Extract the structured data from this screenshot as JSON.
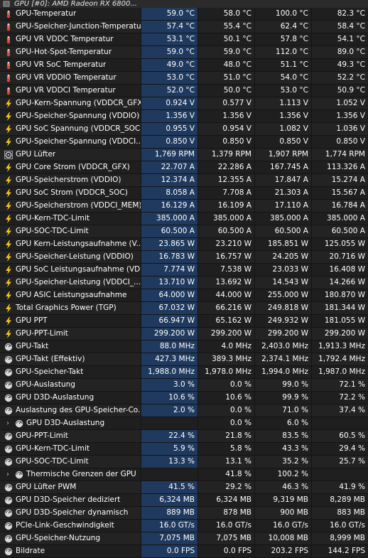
{
  "header": {
    "title": "GPU [#0]: AMD Radeon RX 6800..."
  },
  "rows": [
    {
      "icon": "thermometer",
      "label": "GPU-Temperatur",
      "current": "59.0 °C",
      "min": "58.0 °C",
      "max": "100.0 °C",
      "avg": "82.3 °C"
    },
    {
      "icon": "thermometer",
      "label": "GPU-Speicher-Junction-Temperatur",
      "current": "57.4 °C",
      "min": "55.4 °C",
      "max": "62.4 °C",
      "avg": "58.4 °C"
    },
    {
      "icon": "thermometer",
      "label": "GPU VR VDDC Temperatur",
      "current": "53.1 °C",
      "min": "50.1 °C",
      "max": "57.8 °C",
      "avg": "54.1 °C"
    },
    {
      "icon": "thermometer",
      "label": "GPU-Hot-Spot-Temperatur",
      "current": "59.0 °C",
      "min": "59.0 °C",
      "max": "112.0 °C",
      "avg": "89.0 °C"
    },
    {
      "icon": "thermometer",
      "label": "GPU VR SoC Temperatur",
      "current": "49.0 °C",
      "min": "48.0 °C",
      "max": "51.1 °C",
      "avg": "49.3 °C"
    },
    {
      "icon": "thermometer",
      "label": "GPU VR VDDIO Temperatur",
      "current": "53.0 °C",
      "min": "51.0 °C",
      "max": "54.0 °C",
      "avg": "52.2 °C"
    },
    {
      "icon": "thermometer",
      "label": "GPU VR VDDCI Temperatur",
      "current": "52.0 °C",
      "min": "50.0 °C",
      "max": "53.0 °C",
      "avg": "50.9 °C"
    },
    {
      "icon": "bolt",
      "label": "GPU-Kern-Spannung (VDDCR_GFX)",
      "current": "0.924 V",
      "min": "0.577 V",
      "max": "1.113 V",
      "avg": "1.052 V"
    },
    {
      "icon": "bolt",
      "label": "GPU-Speicher-Spannung (VDDIO)",
      "current": "1.356 V",
      "min": "1.356 V",
      "max": "1.356 V",
      "avg": "1.356 V"
    },
    {
      "icon": "bolt",
      "label": "GPU SoC Spannung (VDDCR_SOC)",
      "current": "0.955 V",
      "min": "0.954 V",
      "max": "1.082 V",
      "avg": "1.036 V"
    },
    {
      "icon": "bolt",
      "label": "GPU-Speicher-Spannung (VDDCI...",
      "current": "0.850 V",
      "min": "0.850 V",
      "max": "0.850 V",
      "avg": "0.850 V"
    },
    {
      "icon": "fan",
      "label": "GPU Lüfter",
      "current": "1,769 RPM",
      "min": "1,379 RPM",
      "max": "1,907 RPM",
      "avg": "1,774 RPM"
    },
    {
      "icon": "bolt",
      "label": "GPU Core Strom (VDDCR_GFX)",
      "current": "22.707 A",
      "min": "22.286 A",
      "max": "167.745 A",
      "avg": "113.326 A"
    },
    {
      "icon": "bolt",
      "label": "GPU-Speicherstrom (VDDIO)",
      "current": "12.374 A",
      "min": "12.355 A",
      "max": "17.847 A",
      "avg": "15.274 A"
    },
    {
      "icon": "bolt",
      "label": "GPU SoC Strom (VDDCR_SOC)",
      "current": "8.058 A",
      "min": "7.708 A",
      "max": "21.303 A",
      "avg": "15.567 A"
    },
    {
      "icon": "bolt",
      "label": "GPU-Speicherstrom (VDDCI_MEM)",
      "current": "16.129 A",
      "min": "16.109 A",
      "max": "17.110 A",
      "avg": "16.784 A"
    },
    {
      "icon": "bolt",
      "label": "GPU-Kern-TDC-Limit",
      "current": "385.000 A",
      "min": "385.000 A",
      "max": "385.000 A",
      "avg": "385.000 A"
    },
    {
      "icon": "bolt",
      "label": "GPU-SOC-TDC-Limit",
      "current": "60.500 A",
      "min": "60.500 A",
      "max": "60.500 A",
      "avg": "60.500 A"
    },
    {
      "icon": "bolt",
      "label": "GPU Kern-Leistungsaufnahme (V...",
      "current": "23.865 W",
      "min": "23.210 W",
      "max": "185.851 W",
      "avg": "125.055 W"
    },
    {
      "icon": "bolt",
      "label": "GPU-Speicher-Leistung (VDDIO)",
      "current": "16.783 W",
      "min": "16.757 W",
      "max": "24.205 W",
      "avg": "20.716 W"
    },
    {
      "icon": "bolt",
      "label": "GPU SoC Leistungsaufnahme (VD...",
      "current": "7.774 W",
      "min": "7.538 W",
      "max": "23.033 W",
      "avg": "16.408 W"
    },
    {
      "icon": "bolt",
      "label": "GPU-Speicher-Leistung (VDDCI_...",
      "current": "13.710 W",
      "min": "13.692 W",
      "max": "14.543 W",
      "avg": "14.266 W"
    },
    {
      "icon": "bolt",
      "label": "GPU ASIC Leistungsaufnahme",
      "current": "64.000 W",
      "min": "44.000 W",
      "max": "255.000 W",
      "avg": "180.870 W"
    },
    {
      "icon": "bolt",
      "label": "Total Graphics Power (TGP)",
      "current": "67.032 W",
      "min": "66.216 W",
      "max": "249.818 W",
      "avg": "181.344 W"
    },
    {
      "icon": "bolt",
      "label": "GPU PPT",
      "current": "66.947 W",
      "min": "65.162 W",
      "max": "249.932 W",
      "avg": "181.055 W"
    },
    {
      "icon": "bolt",
      "label": "GPU-PPT-Limit",
      "current": "299.200 W",
      "min": "299.200 W",
      "max": "299.200 W",
      "avg": "299.200 W"
    },
    {
      "icon": "gauge",
      "label": "GPU-Takt",
      "current": "88.0 MHz",
      "min": "4.0 MHz",
      "max": "2,403.0 MHz",
      "avg": "1,913.3 MHz"
    },
    {
      "icon": "gauge",
      "label": "GPU-Takt (Effektiv)",
      "current": "427.3 MHz",
      "min": "389.3 MHz",
      "max": "2,374.1 MHz",
      "avg": "1,792.4 MHz"
    },
    {
      "icon": "gauge",
      "label": "GPU-Speicher-Takt",
      "current": "1,988.0 MHz",
      "min": "1,978.0 MHz",
      "max": "1,994.0 MHz",
      "avg": "1,987.0 MHz"
    },
    {
      "icon": "gauge",
      "label": "GPU-Auslastung",
      "current": "3.0 %",
      "min": "0.0 %",
      "max": "99.0 %",
      "avg": "72.1 %"
    },
    {
      "icon": "gauge",
      "label": "GPU D3D-Auslastung",
      "current": "10.6 %",
      "min": "10.6 %",
      "max": "99.9 %",
      "avg": "72.2 %"
    },
    {
      "icon": "gauge",
      "label": "Auslastung des GPU-Speicher-Co...",
      "current": "2.0 %",
      "min": "0.0 %",
      "max": "71.0 %",
      "avg": "37.4 %"
    },
    {
      "icon": "gauge",
      "label": "GPU D3D-Auslastung",
      "current": "",
      "min": "0.0 %",
      "max": "6.0 %",
      "avg": "",
      "expand": true
    },
    {
      "icon": "gauge",
      "label": "GPU-PPT-Limit",
      "current": "22.4 %",
      "min": "21.8 %",
      "max": "83.5 %",
      "avg": "60.5 %"
    },
    {
      "icon": "gauge",
      "label": "GPU-Kern-TDC-Limit",
      "current": "5.9 %",
      "min": "5.8 %",
      "max": "43.3 %",
      "avg": "29.4 %"
    },
    {
      "icon": "gauge",
      "label": "GPU-SOC-TDC-Limit",
      "current": "13.3 %",
      "min": "13.1 %",
      "max": "35.2 %",
      "avg": "25.7 %"
    },
    {
      "icon": "gauge",
      "label": "Thermische Grenzen der GPU",
      "current": "",
      "min": "41.8 %",
      "max": "100.2 %",
      "avg": "",
      "expand": true
    },
    {
      "icon": "gauge",
      "label": "GPU Lüfter PWM",
      "current": "41.5 %",
      "min": "29.2 %",
      "max": "46.3 %",
      "avg": "41.9 %"
    },
    {
      "icon": "gauge",
      "label": "GPU D3D-Speicher dediziert",
      "current": "6,324 MB",
      "min": "6,324 MB",
      "max": "9,319 MB",
      "avg": "8,289 MB"
    },
    {
      "icon": "gauge",
      "label": "GPU D3D-Speicher dynamisch",
      "current": "889 MB",
      "min": "878 MB",
      "max": "900 MB",
      "avg": "883 MB"
    },
    {
      "icon": "gauge",
      "label": "PCIe-Link-Geschwindigkeit",
      "current": "16.0 GT/s",
      "min": "16.0 GT/s",
      "max": "16.0 GT/s",
      "avg": "16.0 GT/s"
    },
    {
      "icon": "gauge",
      "label": "GPU-Speicher-Nutzung",
      "current": "7,075 MB",
      "min": "7,075 MB",
      "max": "10,008 MB",
      "avg": "8,999 MB"
    },
    {
      "icon": "gauge",
      "label": "Bildrate",
      "current": "0.0 FPS",
      "min": "0.0 FPS",
      "max": "203.2 FPS",
      "avg": "144.2 FPS"
    }
  ],
  "colors": {
    "current_bg": "#203a5f",
    "bolt": "#f2c318",
    "therm": "#3b6fe0"
  }
}
